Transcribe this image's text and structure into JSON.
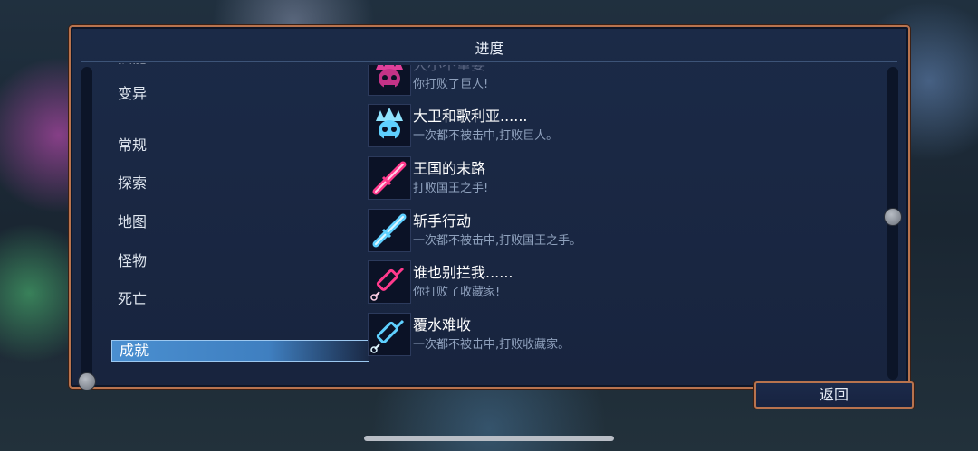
{
  "panel": {
    "title": "进度"
  },
  "categories": [
    {
      "label": "技能",
      "selected": false
    },
    {
      "label": "变异",
      "selected": false
    },
    {
      "label": "常规",
      "selected": false
    },
    {
      "label": "探索",
      "selected": false
    },
    {
      "label": "地图",
      "selected": false
    },
    {
      "label": "怪物",
      "selected": false
    },
    {
      "label": "死亡",
      "selected": false
    },
    {
      "label": "成就",
      "selected": true
    }
  ],
  "achievements": [
    {
      "title": "大小不重要",
      "description": "你打败了巨人!",
      "icon": "skull-crown-icon",
      "color": "#e0409a"
    },
    {
      "title": "大卫和歌利亚......",
      "description": "一次都不被击中,打败巨人。",
      "icon": "skull-crown-icon",
      "color": "#5fd0ff"
    },
    {
      "title": "王国的末路",
      "description": "打败国王之手!",
      "icon": "blade-icon",
      "color": "#ff3a8c"
    },
    {
      "title": "斩手行动",
      "description": "一次都不被击中,打败国王之手。",
      "icon": "blade-icon",
      "color": "#5fd0ff"
    },
    {
      "title": "谁也别拦我......",
      "description": "你打败了收藏家!",
      "icon": "syringe-icon",
      "color": "#ff3a8c"
    },
    {
      "title": "覆水难收",
      "description": "一次都不被击中,打败收藏家。",
      "icon": "syringe-icon",
      "color": "#5fd0ff"
    }
  ],
  "back_button": {
    "label": "返回"
  }
}
